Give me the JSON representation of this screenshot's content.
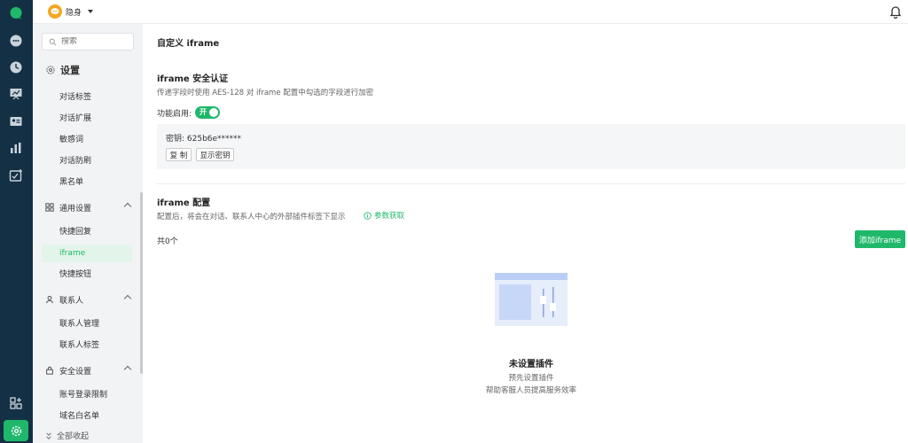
{
  "topbar": {
    "status_label": "隐身"
  },
  "nav": {
    "search_placeholder": "搜索",
    "section_title": "设置",
    "items_top": [
      "对话标签",
      "对话扩展",
      "敏感词",
      "对话防刷",
      "黑名单"
    ],
    "group_general": "通用设置",
    "items_general": [
      "快捷回复",
      "iframe",
      "快捷按钮"
    ],
    "group_contacts": "联系人",
    "items_contacts": [
      "联系人管理",
      "联系人标签"
    ],
    "group_security": "安全设置",
    "items_security": [
      "账号登录限制",
      "域名白名单"
    ],
    "collapse_all": "全部收起"
  },
  "main": {
    "page_title": "自定义 iframe",
    "security": {
      "title": "iframe 安全认证",
      "desc": "传递字段时使用 AES-128 对 iframe 配置中勾选的字段进行加密",
      "toggle_label": "功能启用:",
      "toggle_state": "开",
      "key_label": "密钥:  625b6e******",
      "copy_btn": "复 制",
      "show_key_btn": "显示密钥"
    },
    "config": {
      "title": "iframe 配置",
      "desc": "配置后，将会在对话、联系人中心的外部插件标签下显示",
      "param_link": "参数获取",
      "count": "共0个",
      "add_btn": "添加iframe"
    },
    "empty": {
      "title": "未设置插件",
      "line1": "预先设置插件",
      "line2": "帮助客服人员提高服务效率"
    }
  },
  "colors": {
    "accent": "#1fb86a",
    "rail": "#143044",
    "nav_bg": "#f2f3f5"
  }
}
